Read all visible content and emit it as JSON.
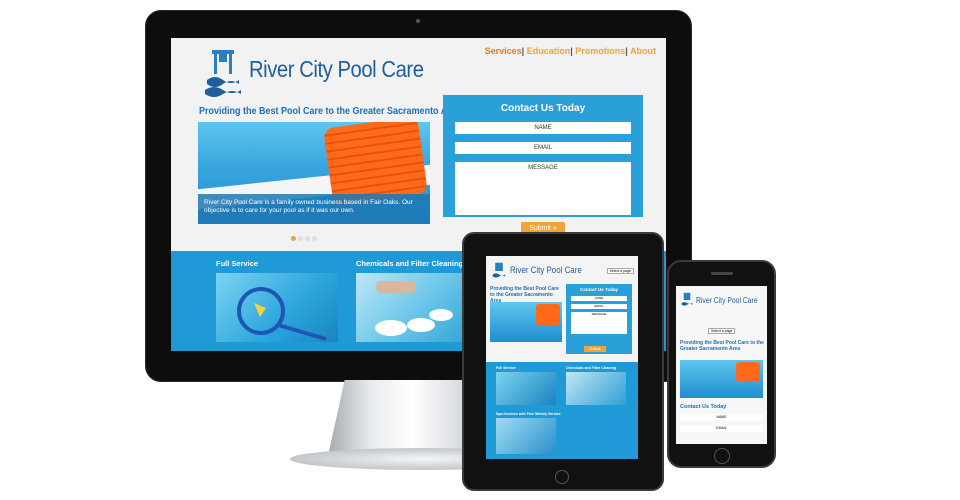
{
  "site": {
    "brand": "River City Pool Care",
    "nav": [
      "Services",
      "Education",
      "Promotions",
      "About"
    ],
    "tagline": "Providing the Best Pool Care to the Greater Sacramento Area",
    "hero_caption": "River City Pool Care is a family owned business based in Fair Oaks. Our objective is to care for your pool as if it was our own.",
    "contact": {
      "title": "Contact Us Today",
      "name_placeholder": "NAME",
      "email_placeholder": "EMAIL",
      "message_placeholder": "MESSAGE",
      "submit": "Submit »"
    },
    "services": [
      "Full Service",
      "Chemicals and Filter Cleaning"
    ],
    "slider": {
      "count": 4,
      "active": 0
    }
  },
  "tablet": {
    "brand": "River City Pool Care",
    "select": "Select a page",
    "tagline": "Providing the Best Pool Care to the Greater Sacramento Area",
    "contact_title": "Contact Us Today",
    "name": "NAME",
    "email": "EMAIL",
    "message": "MESSAGE",
    "submit": "Submit",
    "services": [
      "Full Service",
      "Chemicals and Filter Cleaning",
      "Spa Services with Free Weekly Service"
    ]
  },
  "phone": {
    "brand": "River City Pool Care",
    "select": "Select a page",
    "tagline": "Providing the Best Pool Care to the Greater Sacramento Area",
    "contact_title": "Contact Us Today",
    "name": "NAME",
    "email": "EMAIL"
  },
  "colors": {
    "brand_blue": "#1f5e9c",
    "accent_orange": "#f0a33a",
    "pool_blue": "#1f9ad6"
  }
}
